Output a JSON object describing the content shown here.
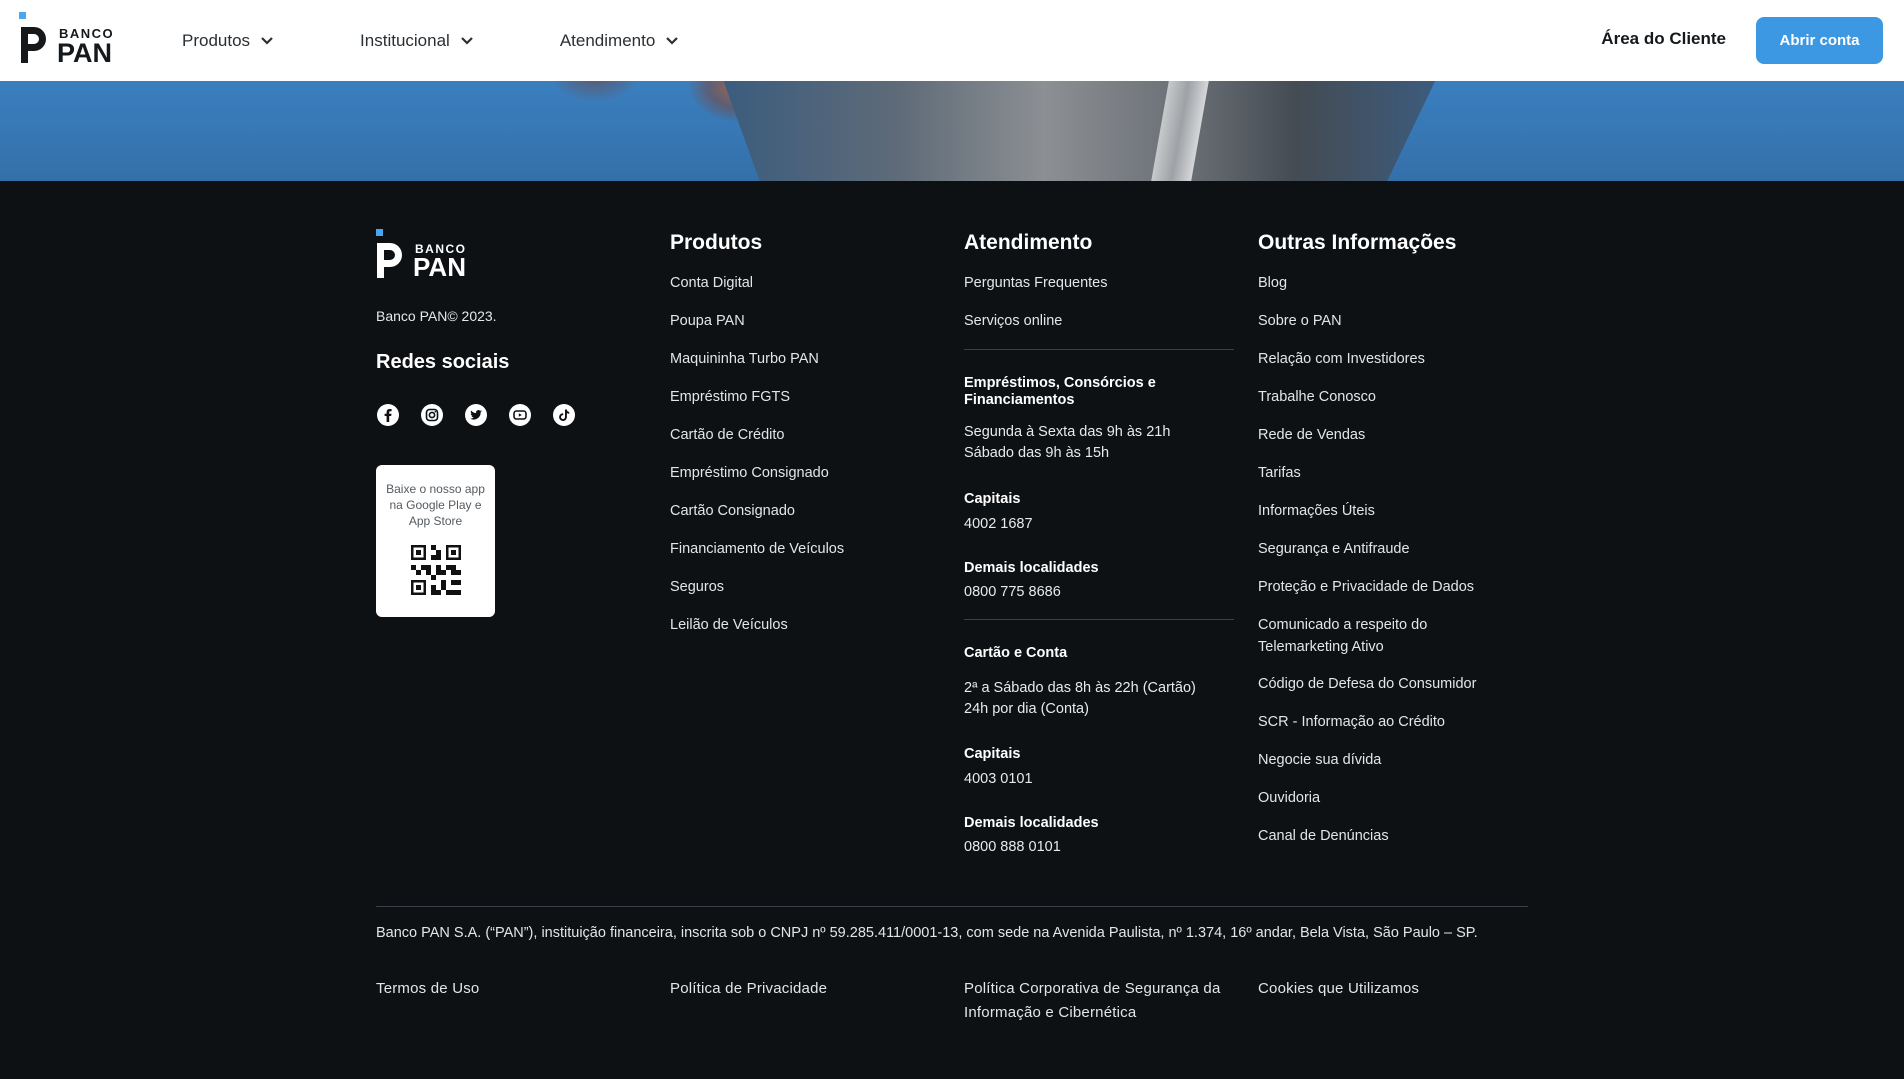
{
  "header": {
    "logo": {
      "top": "BANCO",
      "bottom": "PAN"
    },
    "nav": [
      {
        "label": "Produtos"
      },
      {
        "label": "Institucional"
      },
      {
        "label": "Atendimento"
      }
    ],
    "client_area": "Área do Cliente",
    "open_account": "Abrir conta",
    "colors": {
      "accent": "#3d98e4",
      "logo_dot": "#4aa6ee"
    }
  },
  "footer": {
    "copyright": "Banco PAN© 2023.",
    "social_title": "Redes sociais",
    "socials": [
      "facebook-icon",
      "instagram-icon",
      "twitter-icon",
      "youtube-icon",
      "tiktok-icon"
    ],
    "qr_text": "Baixe o nosso app na Google Play e App Store",
    "products": {
      "title": "Produtos",
      "items": [
        "Conta Digital",
        "Poupa PAN",
        "Maquininha Turbo PAN",
        "Empréstimo FGTS",
        "Cartão de Crédito",
        "Empréstimo Consignado",
        "Cartão Consignado",
        "Financiamento de Veículos",
        "Seguros",
        "Leilão de Veículos"
      ]
    },
    "service": {
      "title": "Atendimento",
      "items": [
        "Perguntas Frequentes",
        "Serviços online"
      ],
      "loans_title": "Empréstimos, Consórcios e Financiamentos",
      "loans_hours_1": "Segunda à Sexta das 9h às 21h",
      "loans_hours_2": "Sábado das 9h às 15h",
      "capitals_label": "Capitais",
      "loans_capitals": "4002 1687",
      "others_label": "Demais localidades",
      "loans_others": "0800 775 8686",
      "card_title": "Cartão e Conta",
      "card_hours_1": "2ª a Sábado das 8h às 22h (Cartão)",
      "card_hours_2": "24h por dia (Conta)",
      "card_capitals": "4003 0101",
      "card_others": "0800 888 0101"
    },
    "other": {
      "title": "Outras Informações",
      "items": [
        "Blog",
        "Sobre o PAN",
        "Relação com Investidores",
        "Trabalhe Conosco",
        "Rede de Vendas",
        "Tarifas",
        "Informações Úteis",
        "Segurança e Antifraude",
        "Proteção e Privacidade de Dados",
        "Comunicado a respeito do Telemarketing Ativo",
        "Código de Defesa do Consumidor",
        "SCR - Informação ao Crédito",
        "Negocie sua dívida",
        "Ouvidoria",
        "Canal de Denúncias"
      ]
    },
    "legal": "Banco PAN S.A. (“PAN”), instituição financeira, inscrita sob o CNPJ nº 59.285.411/0001-13, com sede na Avenida Paulista, nº 1.374, 16º andar, Bela Vista, São Paulo – SP.",
    "bottom_links": [
      "Termos de Uso",
      "Política de Privacidade",
      "Política Corporativa de Segurança da Informação e Cibernética",
      "Cookies que Utilizamos"
    ]
  }
}
